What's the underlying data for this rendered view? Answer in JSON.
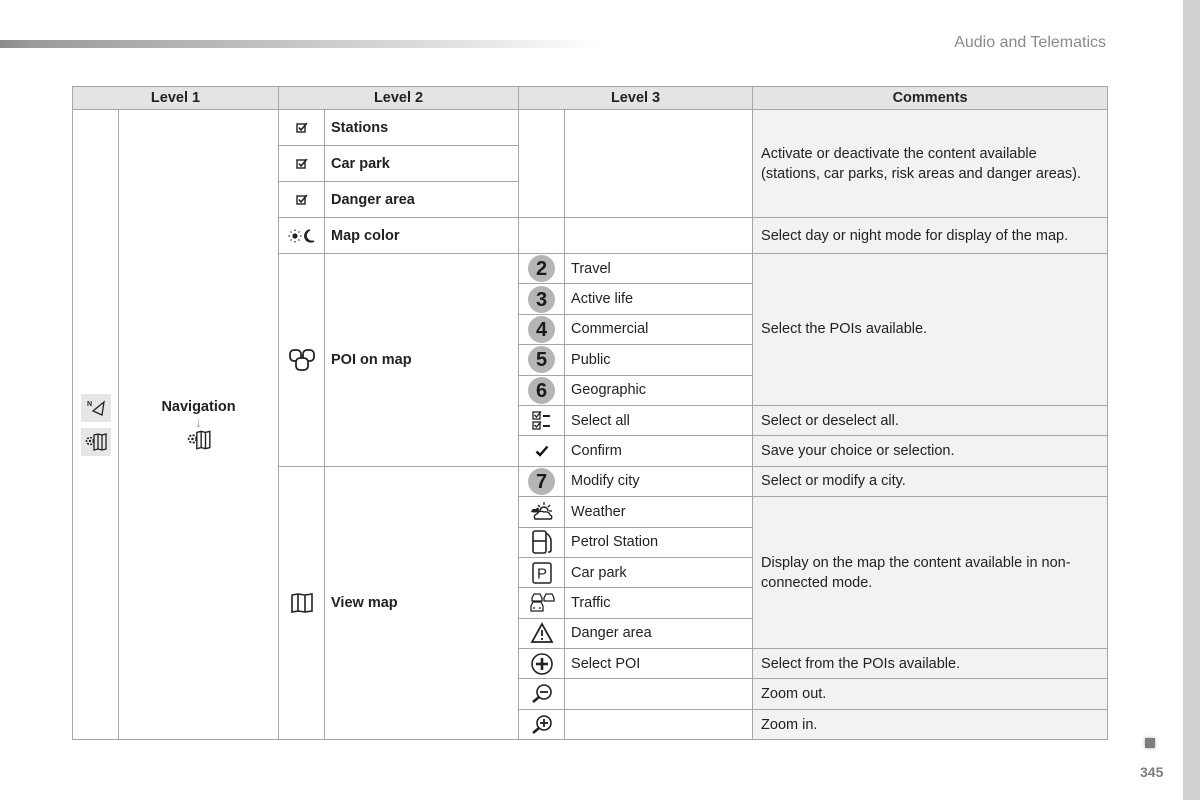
{
  "header": {
    "section_title": "Audio and Telematics",
    "page_number": "345"
  },
  "table": {
    "columns": [
      "Level 1",
      "Level 2",
      "Level 3",
      "Comments"
    ],
    "level1": {
      "icons": [
        "navigation-compass-icon",
        "map-settings-icon"
      ],
      "label": "Navigation",
      "sub_icon": "map-settings-icon"
    },
    "level2": {
      "stations": {
        "icon": "checkbox-icon",
        "label": "Stations"
      },
      "car_park": {
        "icon": "checkbox-icon",
        "label": "Car park"
      },
      "danger_area": {
        "icon": "checkbox-icon",
        "label": "Danger area"
      },
      "map_color": {
        "icon": "day-night-icon",
        "label": "Map color"
      },
      "poi_on_map": {
        "icon": "poi-icon",
        "label": "POI on map"
      },
      "view_map": {
        "icon": "map-icon",
        "label": "View map"
      }
    },
    "comments": {
      "content_toggle": "Activate or deactivate the content available (stations, car parks, risk areas and danger areas).",
      "map_color": "Select day or night mode for display of the map.",
      "select_pois": "Select the POIs available.",
      "select_all": "Select or deselect all.",
      "confirm": "Save your choice or selection.",
      "modify_city": "Select or modify a city.",
      "non_connected": "Display on the map the content available in non-connected mode.",
      "select_poi": "Select from the POIs available.",
      "zoom_out": "Zoom out.",
      "zoom_in": "Zoom in."
    },
    "poi_items": [
      {
        "badge": "2",
        "label": "Travel"
      },
      {
        "badge": "3",
        "label": "Active life"
      },
      {
        "badge": "4",
        "label": "Commercial"
      },
      {
        "badge": "5",
        "label": "Public"
      },
      {
        "badge": "6",
        "label": "Geographic"
      },
      {
        "icon": "select-all-icon",
        "label": "Select all"
      },
      {
        "icon": "checkmark-icon",
        "label": "Confirm"
      }
    ],
    "view_items": [
      {
        "badge": "7",
        "label": "Modify city"
      },
      {
        "icon": "weather-icon",
        "label": "Weather"
      },
      {
        "icon": "petrol-station-icon",
        "label": "Petrol Station"
      },
      {
        "icon": "parking-icon",
        "label": "Car park"
      },
      {
        "icon": "traffic-icon",
        "label": "Traffic"
      },
      {
        "icon": "warning-triangle-icon",
        "label": "Danger area"
      },
      {
        "icon": "plus-circle-icon",
        "label": "Select POI"
      },
      {
        "icon": "zoom-out-icon",
        "label": ""
      },
      {
        "icon": "zoom-in-icon",
        "label": ""
      }
    ]
  }
}
